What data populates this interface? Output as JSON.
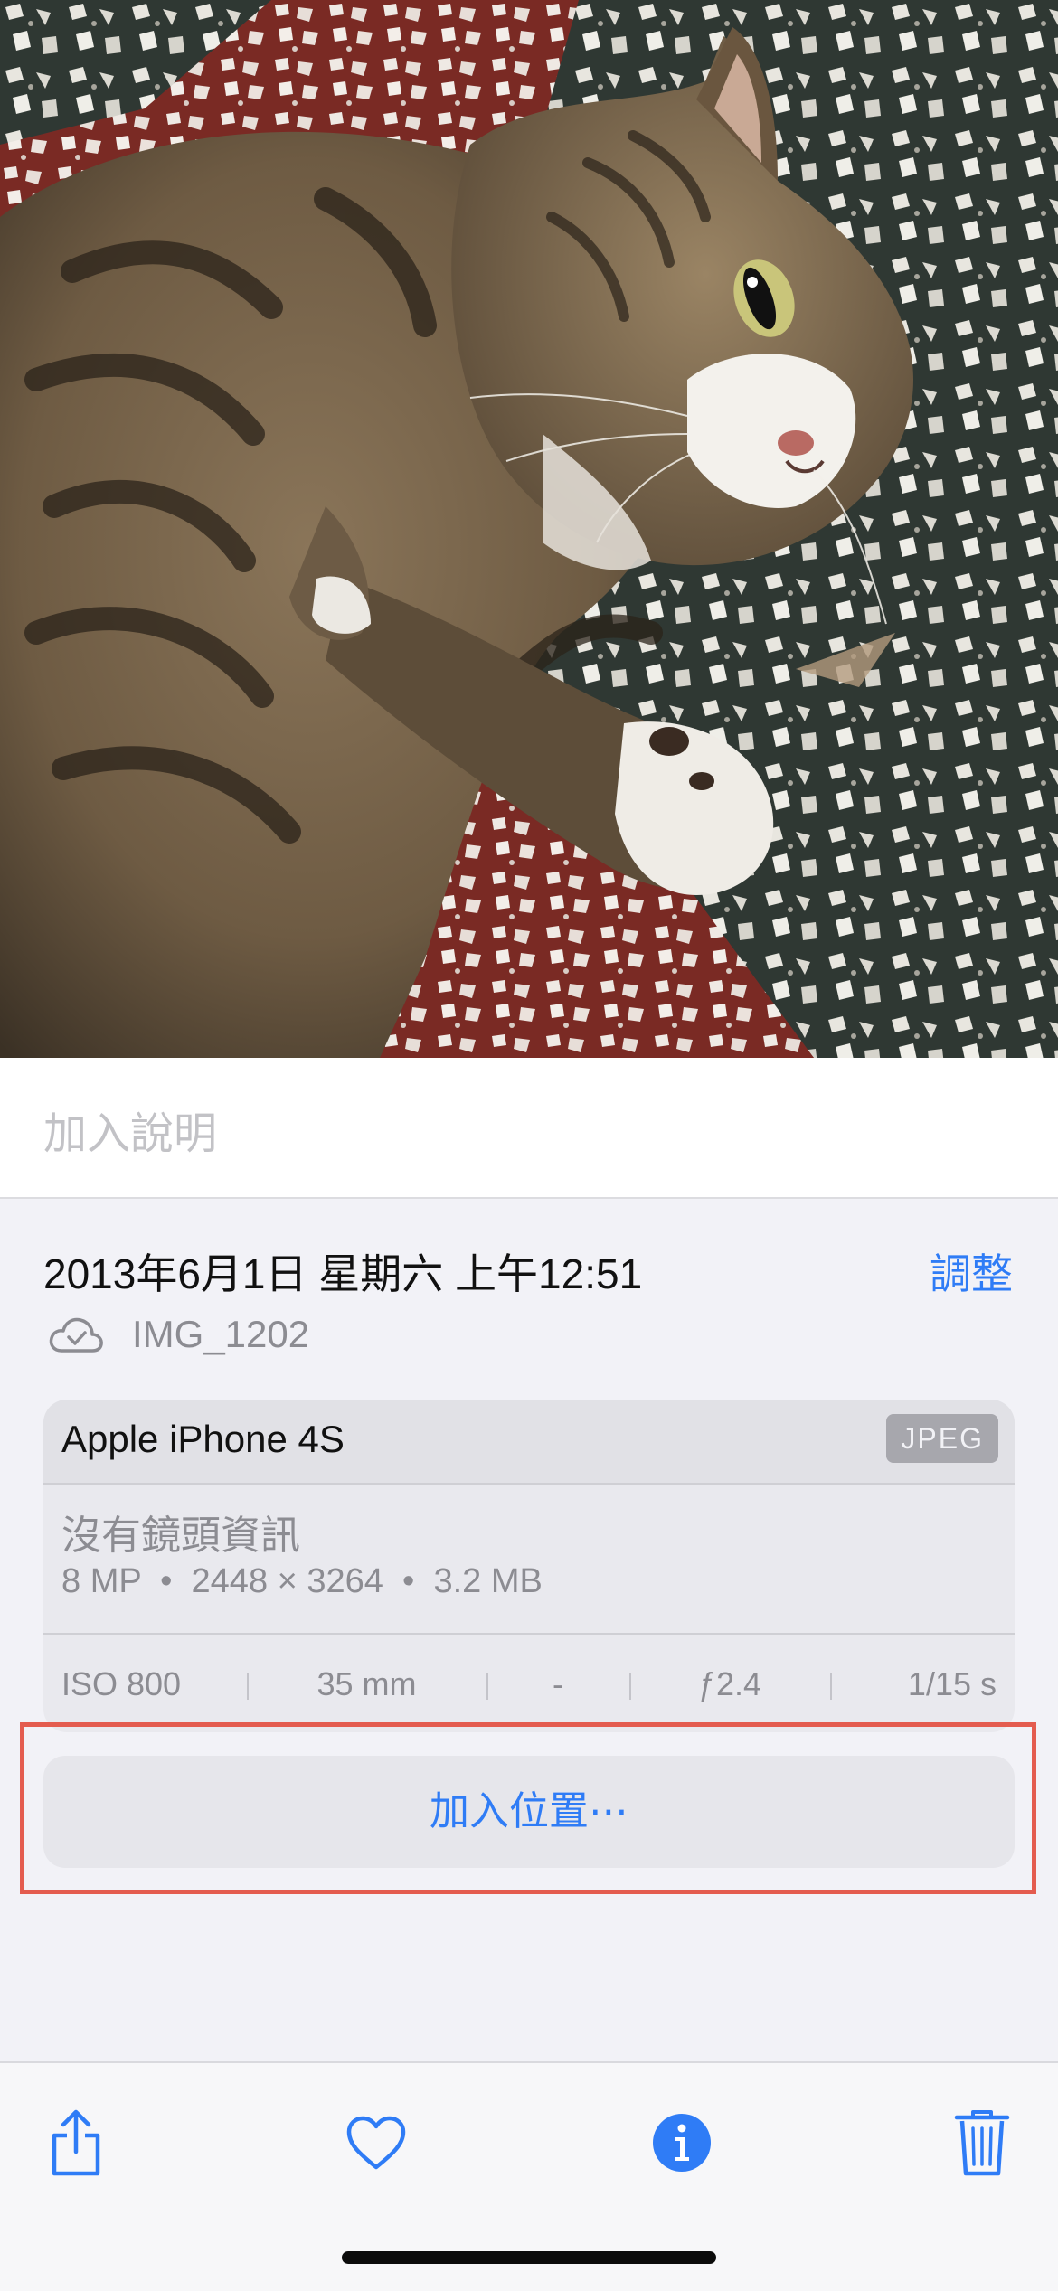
{
  "caption": {
    "placeholder": "加入說明"
  },
  "details": {
    "date": "2013年6月1日 星期六 上午12:51",
    "adjust_label": "調整",
    "file_name": "IMG_1202"
  },
  "camera": {
    "model": "Apple iPhone 4S",
    "format": "JPEG",
    "lens": "沒有鏡頭資訊",
    "specs": "8 MP  •  2448 × 3264  •  3.2 MB",
    "exif": [
      "ISO 800",
      "35 mm",
      "-",
      "ƒ2.4",
      "1/15 s"
    ]
  },
  "location": {
    "add_label": "加入位置⋯"
  },
  "toolbar": {
    "icons": [
      "share-icon",
      "heart-icon",
      "info-icon",
      "trash-icon"
    ]
  },
  "colors": {
    "accent": "#2f7cf6",
    "highlight": "#e45c4f"
  }
}
